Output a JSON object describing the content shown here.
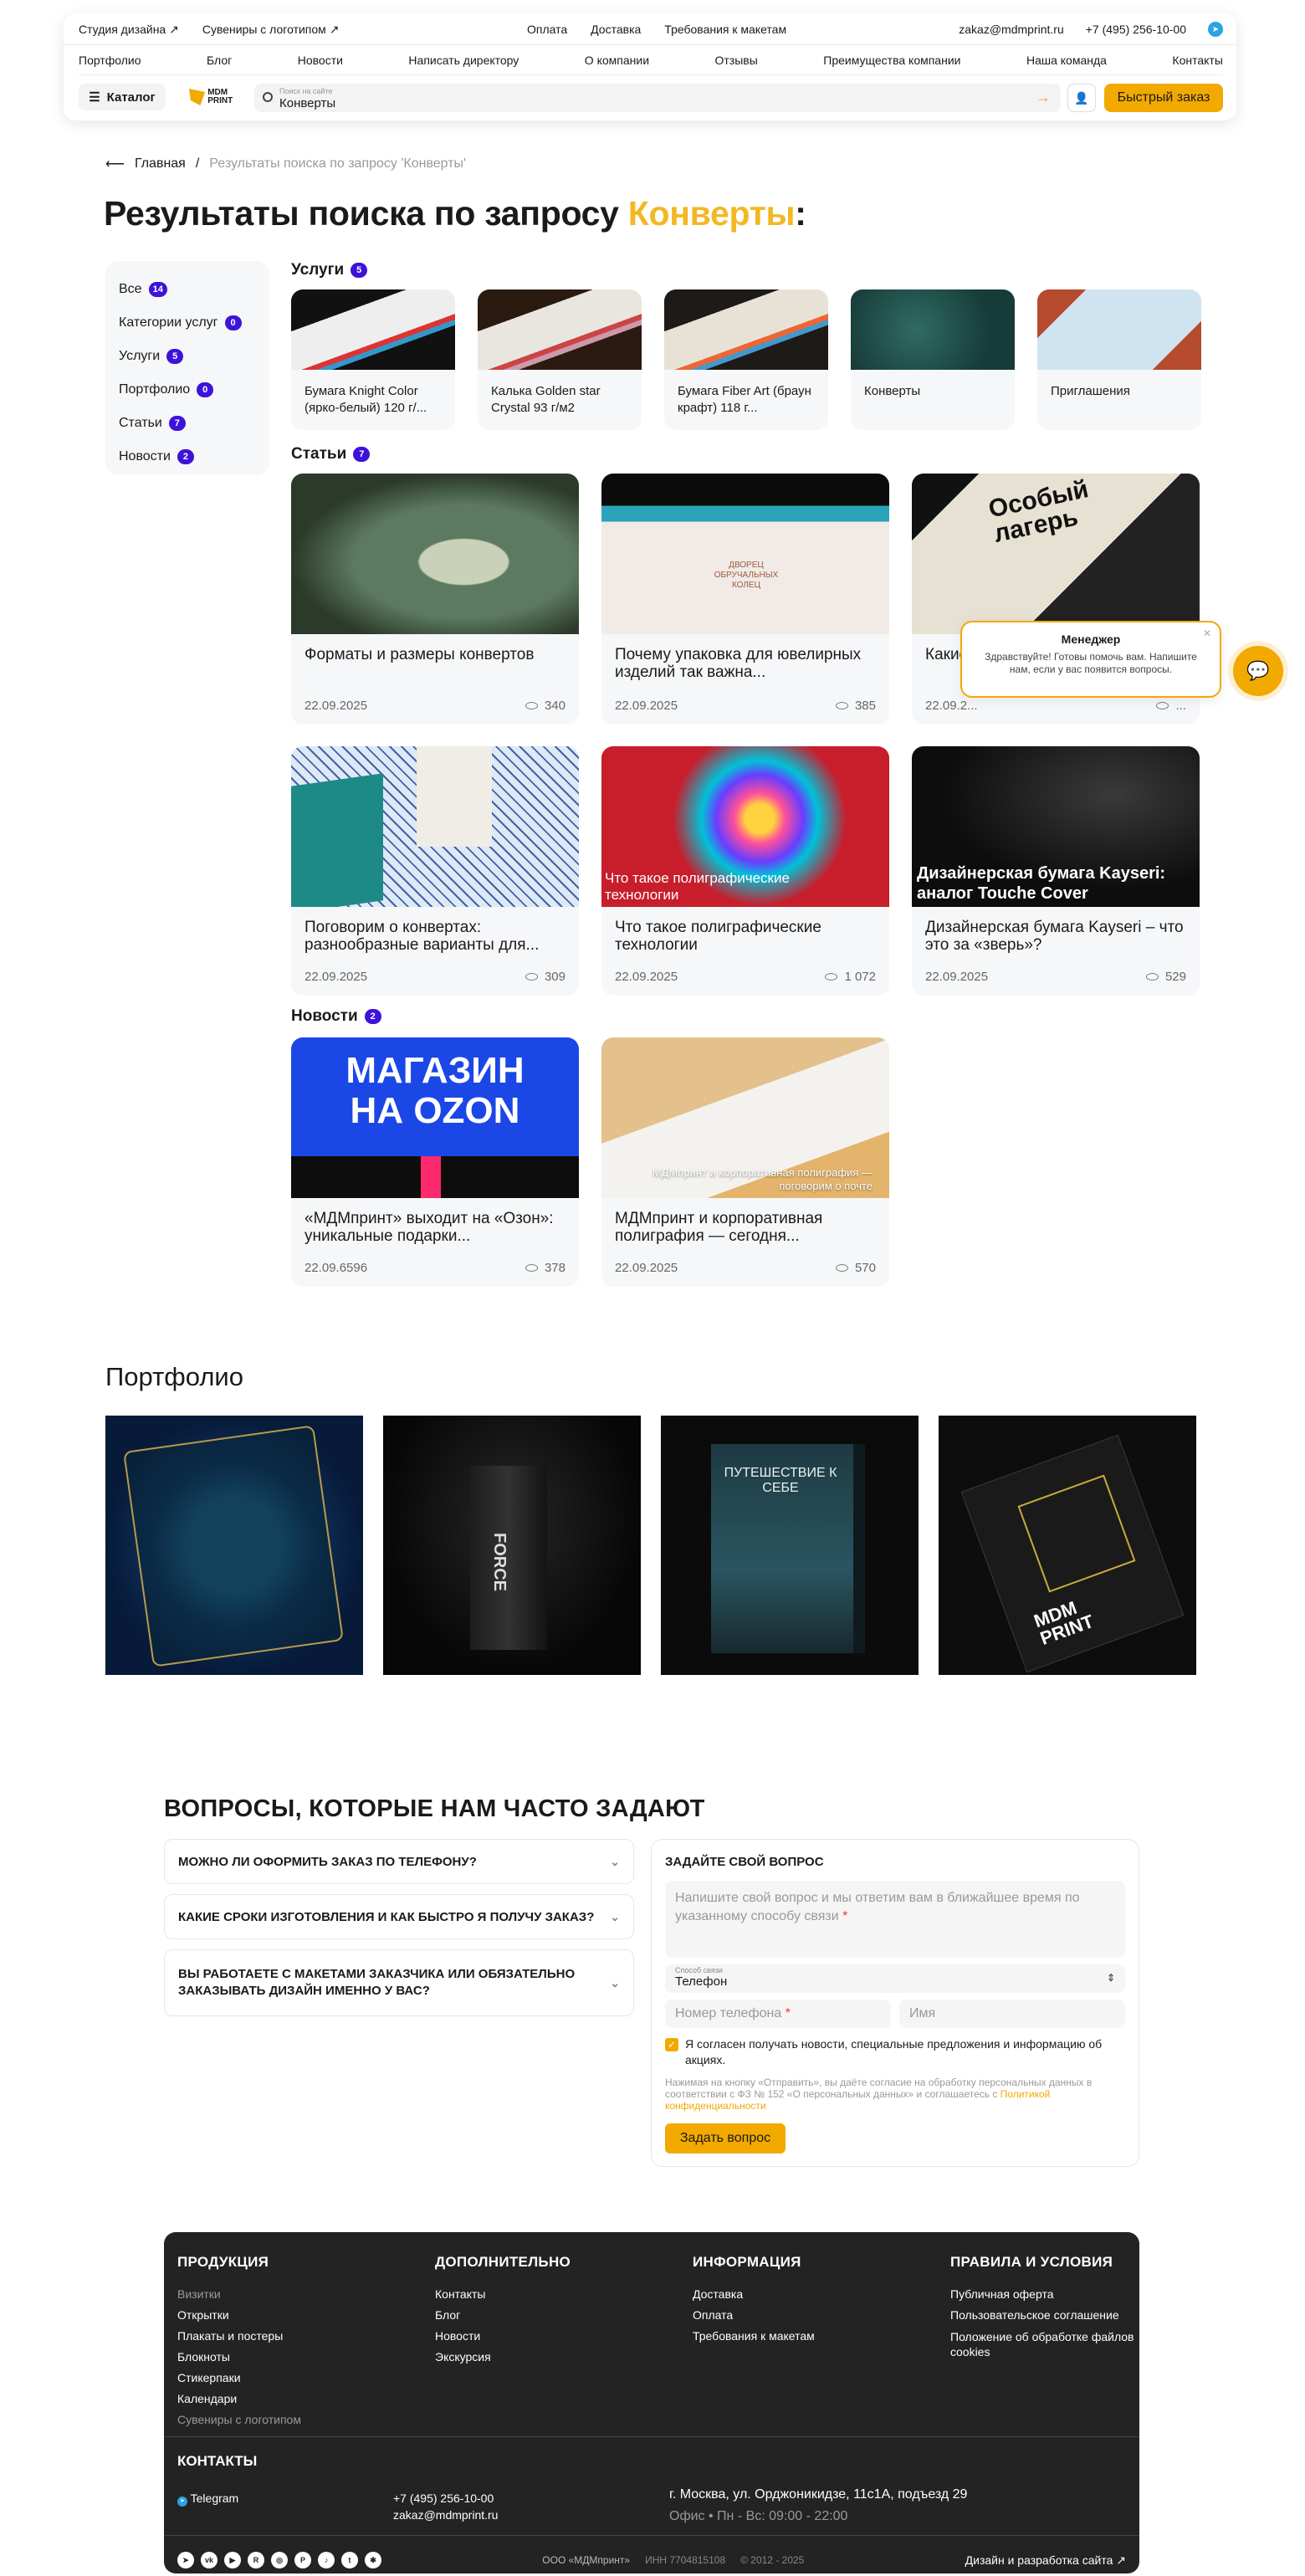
{
  "header": {
    "top_left": [
      "Студия дизайна ↗",
      "Сувениры с логотипом ↗"
    ],
    "top_mid": [
      "Оплата",
      "Доставка",
      "Требования к макетам"
    ],
    "email": "zakaz@mdmprint.ru",
    "phone": "+7 (495) 256-10-00",
    "nav": [
      "Портфолио",
      "Блог",
      "Новости",
      "Написать директору",
      "О компании",
      "Отзывы",
      "Преимущества компании",
      "Наша команда",
      "Контакты"
    ],
    "catalog_label": "Каталог",
    "logo_text": "MDM PRINT",
    "search_placeholder": "Поиск на сайте",
    "search_value": "Конверты",
    "quick_order": "Быстрый заказ"
  },
  "breadcrumb": {
    "home": "Главная",
    "separator": "/",
    "current": "Результаты поиска по запросу 'Конверты'"
  },
  "title": {
    "prefix": "Результаты поиска по запросу ",
    "query": "Конверты",
    "suffix": ":"
  },
  "filters": [
    {
      "label": "Все",
      "count": "14"
    },
    {
      "label": "Категории услуг",
      "count": "0"
    },
    {
      "label": "Услуги",
      "count": "5"
    },
    {
      "label": "Портфолио",
      "count": "0"
    },
    {
      "label": "Статьи",
      "count": "7"
    },
    {
      "label": "Новости",
      "count": "2"
    }
  ],
  "services": {
    "title": "Услуги",
    "count": "5",
    "items": [
      "Бумага Knight Color (ярко-белый) 120 г/...",
      "Калька Golden star Crystal 93 г/м2",
      "Бумага Fiber Art (браун крафт) 118 г...",
      "Конверты",
      "Приглашения"
    ]
  },
  "articles": {
    "title": "Статьи",
    "count": "7",
    "items": [
      {
        "name": "Форматы и размеры конвертов",
        "date": "22.09.2025",
        "views": "340"
      },
      {
        "name": "Почему упаковка для ювелирных изделий так важна...",
        "date": "22.09.2025",
        "views": "385"
      },
      {
        "name": "Какие ... суще...",
        "date": "22.09.2...",
        "views": "..."
      },
      {
        "name": "Поговорим о конвертах: разнообразные варианты для...",
        "date": "22.09.2025",
        "views": "309"
      },
      {
        "name": "Что такое полиграфические технологии",
        "date": "22.09.2025",
        "views": "1 072"
      },
      {
        "name": "Дизайнерская бумага Kayseri – что это за «зверь»?",
        "date": "22.09.2025",
        "views": "529"
      }
    ],
    "overlays": [
      "Что такое полиграфические технологии",
      "Дизайнерская бумага Kayseri: аналог Touche Cover"
    ],
    "image_text": [
      "Особый лагерь",
      "ДВОРЕЦ ОБРУЧАЛЬНЫХ КОЛЕЦ"
    ]
  },
  "news": {
    "title": "Новости",
    "count": "2",
    "items": [
      {
        "name": "«МДМпринт» выходит на «Озон»: уникальные подарки...",
        "date": "22.09.6596",
        "views": "378"
      },
      {
        "name": "МДМпринт и корпоративная полиграфия — сегодня...",
        "date": "22.09.2025",
        "views": "570"
      }
    ],
    "ozon_text": [
      "МАГАЗИН",
      "НА OZON"
    ],
    "corp_overlay": "МДМпринт и корпоративная полиграфия — поговорим о почте"
  },
  "portfolio": {
    "title": "Портфолио",
    "book_title": "ПУТЕШЕСТВИЕ К СЕБЕ",
    "force_text": "FORCE",
    "mdm_text": "MDM PRINT"
  },
  "faq": {
    "title": "ВОПРОСЫ, КОТОРЫЕ НАМ ЧАСТО ЗАДАЮТ",
    "items": [
      "МОЖНО ЛИ ОФОРМИТЬ ЗАКАЗ ПО ТЕЛЕФОНУ?",
      "КАКИЕ СРОКИ ИЗГОТОВЛЕНИЯ И КАК БЫСТРО Я ПОЛУЧУ ЗАКАЗ?",
      "ВЫ РАБОТАЕТЕ С МАКЕТАМИ ЗАКАЗЧИКА ИЛИ ОБЯЗАТЕЛЬНО ЗАКАЗЫВАТЬ ДИЗАЙН ИМЕННО У ВАС?"
    ]
  },
  "ask": {
    "title": "ЗАДАЙТЕ СВОЙ ВОПРОС",
    "textarea_placeholder": "Напишите свой вопрос и мы ответим вам в ближайшее время по указанному способу связи",
    "select_label": "Способ связи",
    "select_value": "Телефон",
    "phone_placeholder": "Номер телефона",
    "name_placeholder": "Имя",
    "consent": "Я согласен получать новости, специальные предложения и информацию об акциях.",
    "legal": "Нажимая на кнопку «Отправить», вы даёте согласие на обработку персональных данных в соответствии с ФЗ № 152 «О персональных данных» и соглашаетесь с ",
    "legal_link": "Политикой конфиденциальности",
    "submit": "Задать вопрос"
  },
  "footer": {
    "cols": [
      {
        "title": "ПРОДУКЦИЯ",
        "items": [
          "Визитки",
          "Открытки",
          "Плакаты и постеры",
          "Блокноты",
          "Стикерпаки",
          "Календари",
          "Сувениры с логотипом"
        ]
      },
      {
        "title": "ДОПОЛНИТЕЛЬНО",
        "items": [
          "Контакты",
          "Блог",
          "Новости",
          "Экскурсия"
        ]
      },
      {
        "title": "ИНФОРМАЦИЯ",
        "items": [
          "Доставка",
          "Оплата",
          "Требования к макетам"
        ]
      },
      {
        "title": "ПРАВИЛА И УСЛОВИЯ",
        "items": [
          "Публичная оферта",
          "Пользовательское соглашение",
          "Положение об обработке файлов cookies"
        ]
      }
    ],
    "contacts_title": "КОНТАКТЫ",
    "telegram": "Telegram",
    "phone": "+7 (495) 256-10-00",
    "email": "zakaz@mdmprint.ru",
    "address": "г. Москва, ул. Орджоникидзе, 11с1А, подъезд 29",
    "hours": "Офис • Пн - Вс: 09:00 - 22:00",
    "company": "ООО «МДМпринт»",
    "inn": "ИНН 7704815108",
    "years": "© 2012 - 2025",
    "dev": "Дизайн и разработка сайта ↗"
  },
  "manager": {
    "title": "Менеджер",
    "text": "Здравствуйте! Готовы помочь вам. Напишите нам, если у вас появится вопросы."
  },
  "colors": {
    "accent": "#f2a900",
    "badge": "#3e12d8",
    "footer": "#232323"
  }
}
